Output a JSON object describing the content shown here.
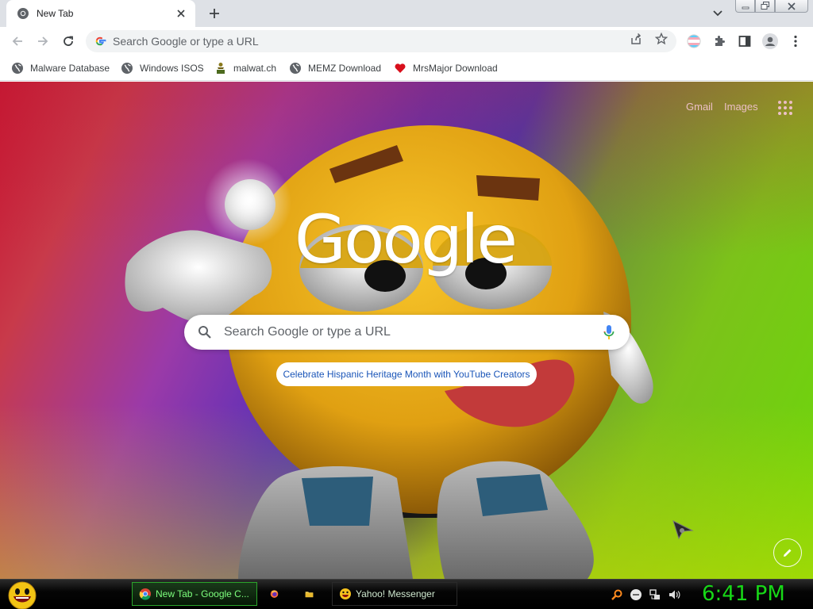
{
  "browser": {
    "tab": {
      "title": "New Tab"
    },
    "omnibox": {
      "placeholder": "Search Google or type a URL"
    },
    "bookmarks": [
      {
        "label": "Malware Database",
        "icon": "globe-icon"
      },
      {
        "label": "Windows ISOS",
        "icon": "globe-icon"
      },
      {
        "label": "malwat.ch",
        "icon": "folder-person-icon"
      },
      {
        "label": "MEMZ Download",
        "icon": "globe-icon"
      },
      {
        "label": "MrsMajor Download",
        "icon": "heart-icon"
      }
    ]
  },
  "ntp": {
    "links": {
      "gmail": "Gmail",
      "images": "Images"
    },
    "logo": "Google",
    "search": {
      "placeholder": "Search Google or type a URL"
    },
    "promo": "Celebrate Hispanic Heritage Month with YouTube Creators"
  },
  "taskbar": {
    "tasks": [
      {
        "label": "New Tab - Google C...",
        "icon": "chrome-icon",
        "active": true
      },
      {
        "label": "",
        "icon": "firefox-icon"
      },
      {
        "label": "",
        "icon": "folder-icon"
      },
      {
        "label": "Yahoo! Messenger",
        "icon": "yahoo-smiley-icon"
      }
    ],
    "clock": "6:41 PM"
  },
  "colors": {
    "clock": "#17d817",
    "taskbar": "#000000",
    "chrome_frame": "#dee1e6",
    "promo_text": "#1a55b8"
  }
}
